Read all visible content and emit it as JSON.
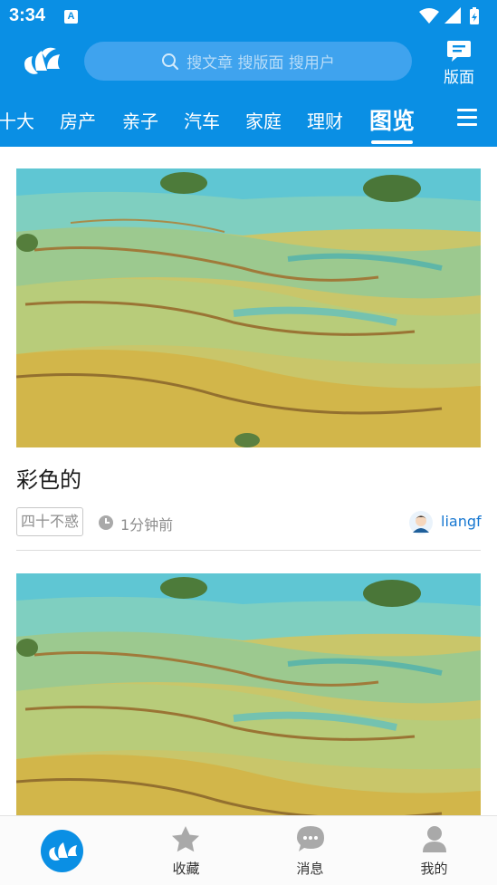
{
  "status_bar": {
    "time": "3:34",
    "badge": "A"
  },
  "header": {
    "search_placeholder": "搜文章 搜版面 搜用户",
    "board_label": "版面"
  },
  "tabs": [
    {
      "label": "十大"
    },
    {
      "label": "房产"
    },
    {
      "label": "亲子"
    },
    {
      "label": "汽车"
    },
    {
      "label": "家庭"
    },
    {
      "label": "理财"
    },
    {
      "label": "图览",
      "active": true
    }
  ],
  "feed": [
    {
      "title": "彩色的",
      "tag": "四十不惑",
      "time": "1分钟前",
      "author": "liangf"
    },
    {
      "title": "",
      "tag": "",
      "time": "",
      "author": ""
    }
  ],
  "bottom_nav": [
    {
      "label": "",
      "icon": "home-logo-icon",
      "active": true
    },
    {
      "label": "收藏",
      "icon": "star-icon"
    },
    {
      "label": "消息",
      "icon": "chat-icon"
    },
    {
      "label": "我的",
      "icon": "user-icon"
    }
  ],
  "colors": {
    "primary": "#0a8fe4",
    "link": "#1677d1",
    "muted": "#8d8d8d"
  }
}
